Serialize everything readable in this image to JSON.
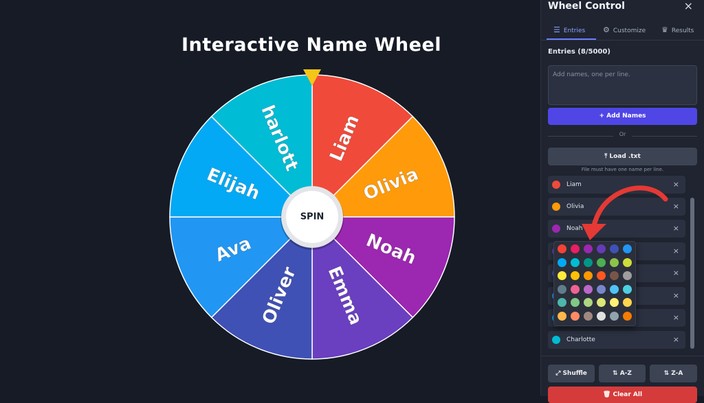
{
  "page_title": "Interactive Name Wheel",
  "wheel": {
    "spin_label": "SPIN",
    "pointer_color": "#f5c518",
    "segments": [
      {
        "label": "Liam",
        "color": "#f04a3a"
      },
      {
        "label": "Olivia",
        "color": "#ff9a0a"
      },
      {
        "label": "Noah",
        "color": "#9c27b0"
      },
      {
        "label": "Emma",
        "color": "#6a3fc0"
      },
      {
        "label": "Oliver",
        "color": "#3f51b5"
      },
      {
        "label": "Ava",
        "color": "#2196f3"
      },
      {
        "label": "Elijah",
        "color": "#03a9f4"
      },
      {
        "label": "harlott",
        "color": "#00bcd4"
      }
    ]
  },
  "panel": {
    "title": "Wheel Control",
    "close_icon": "×",
    "tabs": [
      {
        "label": "Entries",
        "icon": "list-icon",
        "glyph": "☰"
      },
      {
        "label": "Customize",
        "icon": "gear-icon",
        "glyph": "⚙"
      },
      {
        "label": "Results",
        "icon": "trophy-icon",
        "glyph": "♛"
      }
    ],
    "entries_count": "Entries (8/5000)",
    "textarea_placeholder": "Add names, one per line.",
    "add_button": "+  Add Names",
    "or_text": "Or",
    "load_button": "⤒  Load .txt",
    "load_hint": "File must have one name per line.",
    "entries": [
      {
        "name": "Liam",
        "color": "#f04a3a"
      },
      {
        "name": "Olivia",
        "color": "#ff9a0a"
      },
      {
        "name": "Noah",
        "color": "#9c27b0"
      },
      {
        "name": "",
        "color": "#6a3fc0"
      },
      {
        "name": "",
        "color": "#3f51b5"
      },
      {
        "name": "",
        "color": "#2196f3"
      },
      {
        "name": "",
        "color": "#03a9f4"
      },
      {
        "name": "Charlotte",
        "color": "#00bcd4"
      }
    ],
    "delete_glyph": "×",
    "footer": {
      "shuffle": "⤢ Shuffle",
      "az": "⇅ A-Z",
      "za": "⇅ Z-A",
      "clear": "🗑 Clear All"
    }
  },
  "palette": {
    "colors": [
      "#f44336",
      "#e91e63",
      "#9c27b0",
      "#673ab7",
      "#3f51b5",
      "#2196f3",
      "#03a9f4",
      "#00bcd4",
      "#009688",
      "#4caf50",
      "#8bc34a",
      "#cddc39",
      "#ffeb3b",
      "#ffc107",
      "#ff9800",
      "#ff5722",
      "#795548",
      "#9e9e9e",
      "#607d8b",
      "#f06292",
      "#ba68c8",
      "#7986cb",
      "#4fc3f7",
      "#4dd0e1",
      "#4db6ac",
      "#81c784",
      "#aed581",
      "#dce775",
      "#fff176",
      "#ffd54f",
      "#ffb74d",
      "#ff8a65",
      "#a1887f",
      "#e0e0e0",
      "#90a4ae",
      "#f57c00"
    ]
  },
  "annotation_arrow_color": "#e53935"
}
